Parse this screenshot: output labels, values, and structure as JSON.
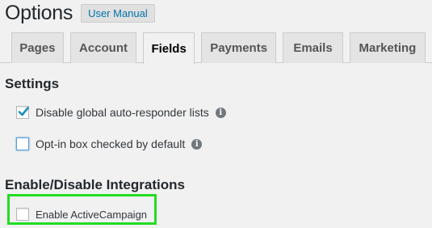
{
  "header": {
    "title": "Options",
    "manual_button": "User Manual"
  },
  "tabs": [
    {
      "label": "Pages",
      "active": false
    },
    {
      "label": "Account",
      "active": false
    },
    {
      "label": "Fields",
      "active": true
    },
    {
      "label": "Payments",
      "active": false
    },
    {
      "label": "Emails",
      "active": false
    },
    {
      "label": "Marketing",
      "active": false
    }
  ],
  "settings": {
    "heading": "Settings",
    "options": [
      {
        "label": "Disable global auto-responder lists",
        "checked": true,
        "info_icon": "info-icon"
      },
      {
        "label": "Opt-in box checked by default",
        "checked": false,
        "info_icon": "info-icon"
      }
    ]
  },
  "integrations": {
    "heading": "Enable/Disable Integrations",
    "options": [
      {
        "label": "Enable ActiveCampaign",
        "checked": false
      }
    ]
  },
  "colors": {
    "highlight": "#22dd22",
    "link": "#0073aa",
    "checkmark": "#1e8cbe"
  }
}
